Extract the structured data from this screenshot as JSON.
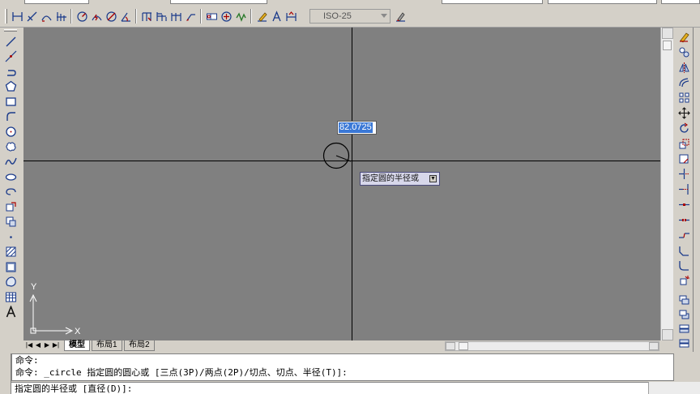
{
  "app": {
    "accent": "#3a78d6",
    "canvas_bg": "#808080"
  },
  "toolbar": {
    "dim_style": "ISO-25",
    "dimension_icons": [
      "linear-dim-icon",
      "aligned-dim-icon",
      "arc-length-icon",
      "ordinate-dim-icon",
      "radius-dim-icon",
      "jogged-dim-icon",
      "diameter-dim-icon",
      "angular-dim-icon",
      "quick-dim-icon",
      "baseline-dim-icon",
      "continue-dim-icon",
      "quick-leader-icon",
      "tolerance-icon",
      "center-mark-icon",
      "inspect-icon",
      "jogged-linear-icon",
      "dim-edit-icon",
      "dim-text-edit-icon",
      "dim-update-icon",
      "dim-style-icon"
    ]
  },
  "draw_toolbar": [
    "line-icon",
    "construction-line-icon",
    "polyline-icon",
    "polygon-icon",
    "rectangle-icon",
    "arc-icon",
    "circle-icon",
    "revision-cloud-icon",
    "spline-icon",
    "ellipse-icon",
    "ellipse-arc-icon",
    "insert-block-icon",
    "make-block-icon",
    "point-icon",
    "hatch-icon",
    "gradient-icon",
    "region-icon",
    "table-icon",
    "multiline-text-icon"
  ],
  "modify_toolbar": [
    "erase-icon",
    "copy-icon",
    "mirror-icon",
    "offset-icon",
    "array-icon",
    "move-icon",
    "rotate-icon",
    "scale-icon",
    "stretch-icon",
    "trim-icon",
    "extend-icon",
    "break-at-point-icon",
    "break-icon",
    "join-icon",
    "chamfer-icon",
    "fillet-icon",
    "explode-icon"
  ],
  "dynamic_input": {
    "value": "82.0725",
    "prompt": "指定圆的半径或"
  },
  "ucs": {
    "x_label": "X",
    "y_label": "Y"
  },
  "tabs": [
    {
      "label": "模型",
      "active": true
    },
    {
      "label": "布局1",
      "active": false
    },
    {
      "label": "布局2",
      "active": false
    }
  ],
  "command": {
    "history": [
      "命令:",
      "命令: _circle 指定圆的圆心或 [三点(3P)/两点(2P)/切点、切点、半径(T)]:"
    ],
    "current": "指定圆的半径或 [直径(D)]:"
  }
}
